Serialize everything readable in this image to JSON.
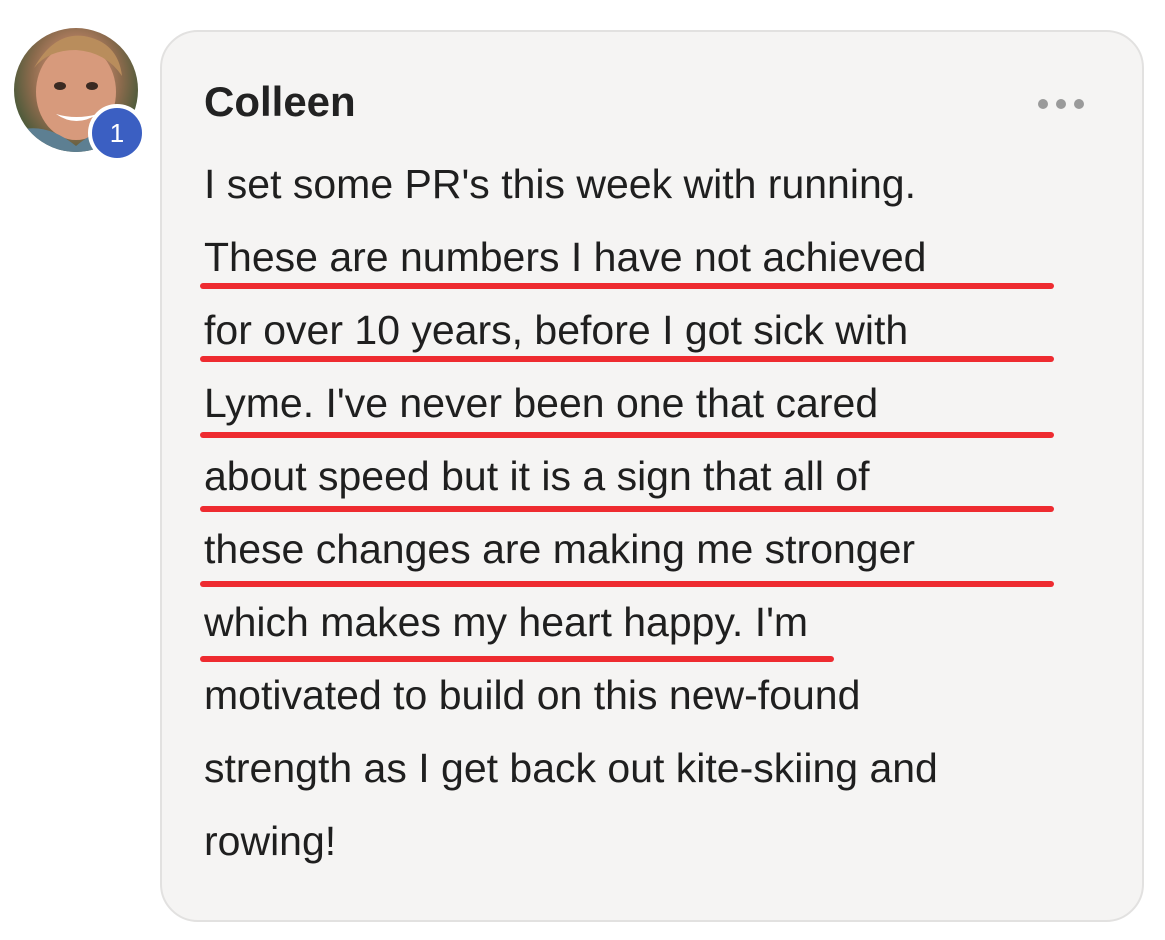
{
  "comment": {
    "author": "Colleen",
    "badge_count": "1",
    "lines": [
      "I set some PR's this week with running.",
      "These are numbers I have not achieved",
      "for over 10 years, before I got sick with",
      "Lyme. I've never been one that cared",
      "about speed but it is a sign that all of",
      "these changes are making me stronger",
      "which makes my heart happy. I'm",
      "motivated to build on this new-found",
      "strength as I get back out kite-skiing and",
      "rowing!"
    ]
  },
  "colors": {
    "bubble_background": "#f5f4f3",
    "badge": "#3b5fc2",
    "highlight_underline": "#ee2b30"
  },
  "icons": {
    "more": "more-horizontal-icon"
  }
}
